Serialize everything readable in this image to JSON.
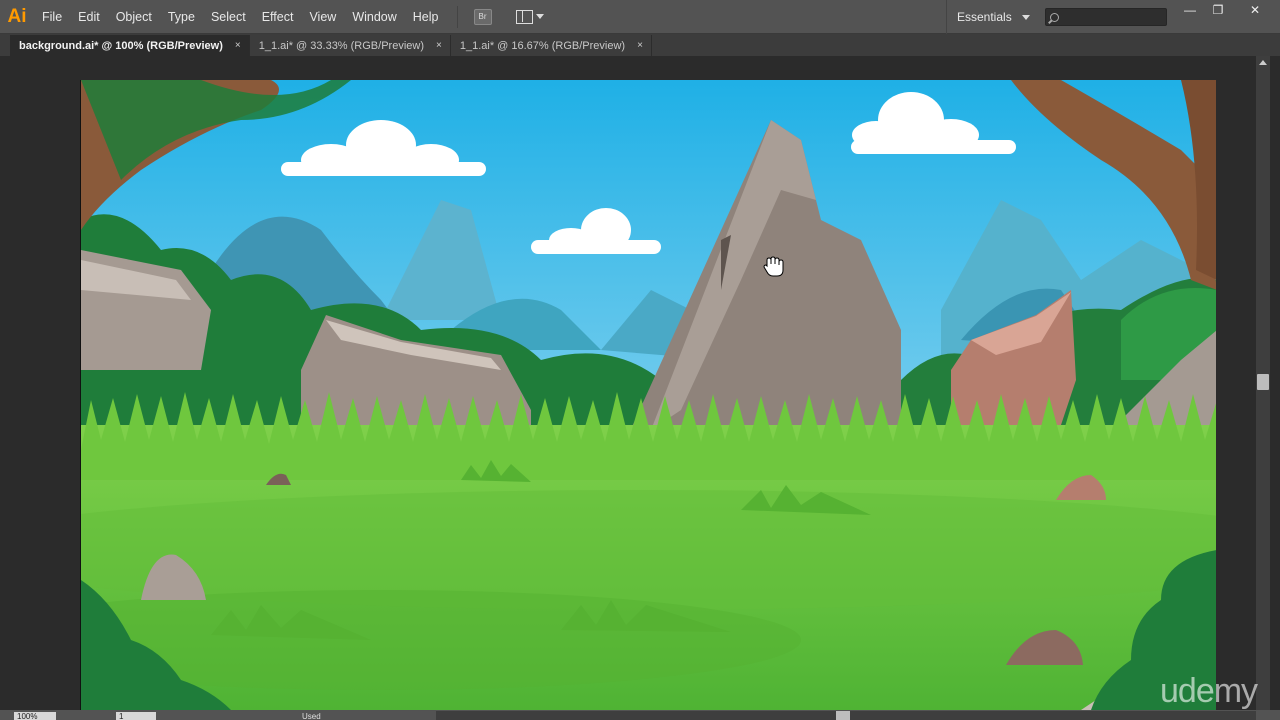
{
  "app": {
    "logo": "Ai"
  },
  "menu": [
    "File",
    "Edit",
    "Object",
    "Type",
    "Select",
    "Effect",
    "View",
    "Window",
    "Help"
  ],
  "toolbar": {
    "bridge_label": "Br"
  },
  "workspace": {
    "label": "Essentials"
  },
  "search": {
    "placeholder": ""
  },
  "window_controls": {
    "minimize": "—",
    "maximize": "❐",
    "close": "✕"
  },
  "tabs": [
    {
      "label": "background.ai* @ 100% (RGB/Preview)",
      "active": true
    },
    {
      "label": "1_1.ai* @ 33.33% (RGB/Preview)",
      "active": false
    },
    {
      "label": "1_1.ai* @ 16.67% (RGB/Preview)",
      "active": false
    }
  ],
  "tab_close": "×",
  "status": {
    "zoom": "100%",
    "artboard": "1",
    "text": "Used"
  },
  "watermark": "udemy",
  "colors": {
    "sky_top": "#23b4e8",
    "sky_bottom": "#c9ecf6",
    "grass": "#66c23c",
    "rock": "#9d8e84",
    "tree": "#8a5a3a",
    "logo": "#ff9a00"
  }
}
